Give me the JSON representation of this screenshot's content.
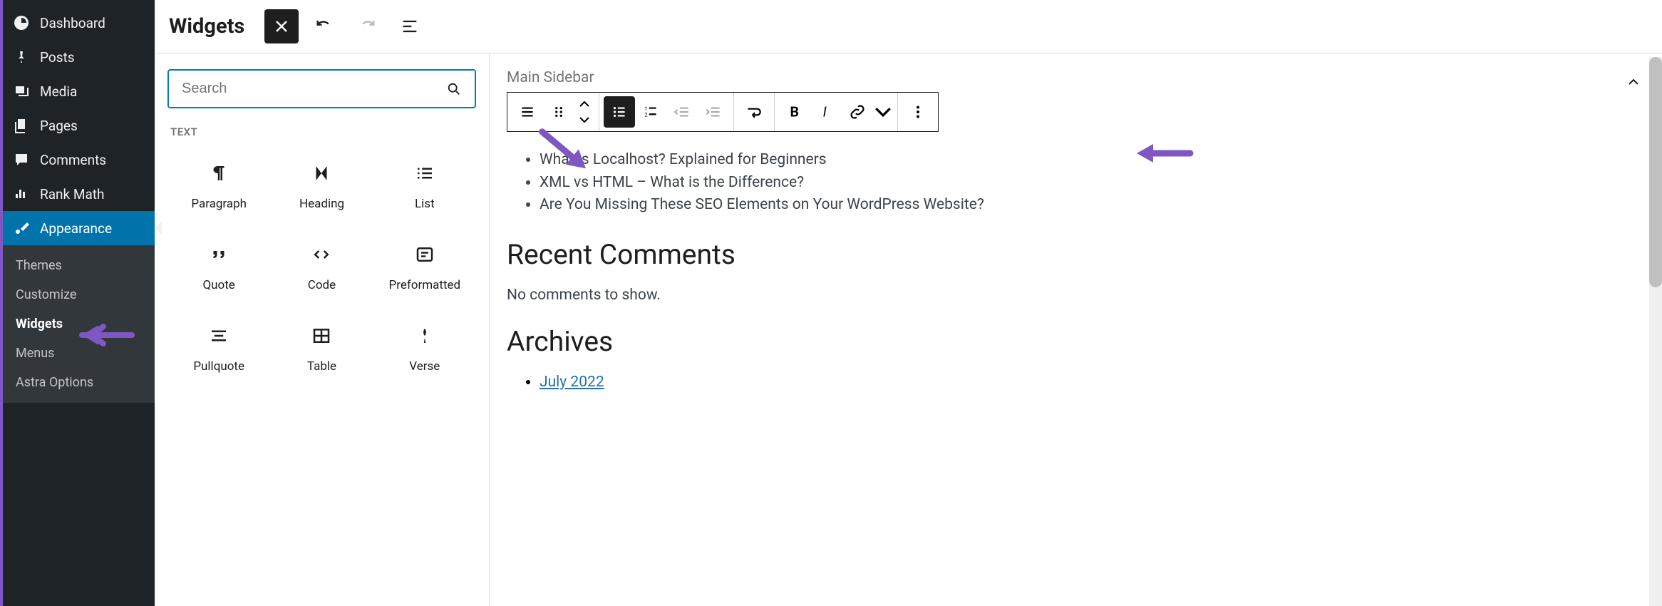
{
  "sidebar": {
    "items": [
      {
        "label": "Dashboard"
      },
      {
        "label": "Posts"
      },
      {
        "label": "Media"
      },
      {
        "label": "Pages"
      },
      {
        "label": "Comments"
      },
      {
        "label": "Rank Math"
      },
      {
        "label": "Appearance"
      }
    ],
    "submenu": [
      {
        "label": "Themes"
      },
      {
        "label": "Customize"
      },
      {
        "label": "Widgets"
      },
      {
        "label": "Menus"
      },
      {
        "label": "Astra Options"
      }
    ]
  },
  "topbar": {
    "title": "Widgets"
  },
  "inserter": {
    "search_placeholder": "Search",
    "category": "TEXT",
    "blocks": [
      {
        "label": "Paragraph"
      },
      {
        "label": "Heading"
      },
      {
        "label": "List"
      },
      {
        "label": "Quote"
      },
      {
        "label": "Code"
      },
      {
        "label": "Preformatted"
      },
      {
        "label": "Pullquote"
      },
      {
        "label": "Table"
      },
      {
        "label": "Verse"
      }
    ]
  },
  "canvas": {
    "section": "Main Sidebar",
    "posts": [
      "What is Localhost? Explained for Beginners",
      "XML vs HTML – What is the Difference?",
      "Are You Missing These SEO Elements on Your WordPress Website?"
    ],
    "recent_comments_heading": "Recent Comments",
    "no_comments": "No comments to show.",
    "archives_heading": "Archives",
    "archive_link": "July 2022"
  },
  "colors": {
    "accent": "#7e57c2",
    "primary": "#007cba",
    "sidebar_bg": "#1d2327"
  }
}
